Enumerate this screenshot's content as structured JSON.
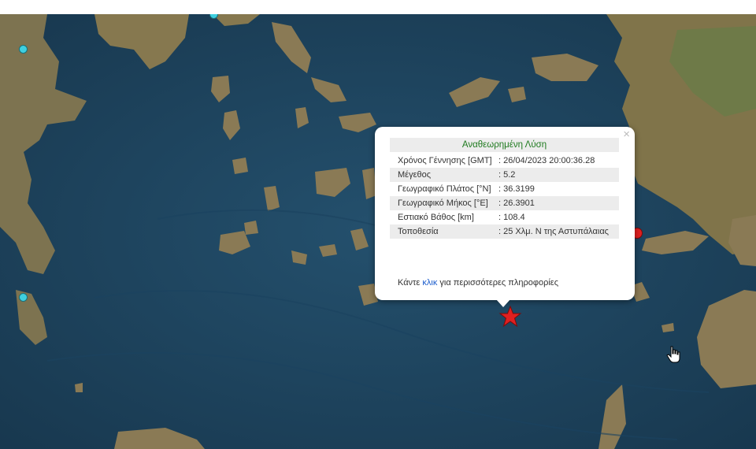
{
  "popup": {
    "close_symbol": "×",
    "title": "Αναθεωρημένη Λύση",
    "rows": [
      {
        "label": "Χρόνος Γέννησης [GMT]",
        "value": ": 26/04/2023 20:00:36.28"
      },
      {
        "label": "Μέγεθος",
        "value": ": 5.2"
      },
      {
        "label": "Γεωγραφικό Πλάτος [°N]",
        "value": ": 36.3199"
      },
      {
        "label": "Γεωγραφικό Μήκος [°E]",
        "value": ": 26.3901"
      },
      {
        "label": "Εστιακό Βάθος [km]",
        "value": ": 108.4"
      },
      {
        "label": "Τοποθεσία",
        "value": ": 25 Χλμ. Ν της Αστυπάλαιας"
      }
    ],
    "more_prefix": "Κάντε",
    "more_link": "κλικ",
    "more_suffix": "για περισσότερες πληροφορίες"
  },
  "colors": {
    "sea": "#1f4a66",
    "land": "#8a7a55",
    "title_green": "#1e7a1e",
    "link_blue": "#1a5ccc",
    "marker_cyan": "#3fd0e0",
    "marker_red": "#e02020",
    "epicenter_star": "#e02020"
  },
  "icons": {
    "epicenter": "star-icon",
    "cursor": "hand-cursor-icon"
  }
}
